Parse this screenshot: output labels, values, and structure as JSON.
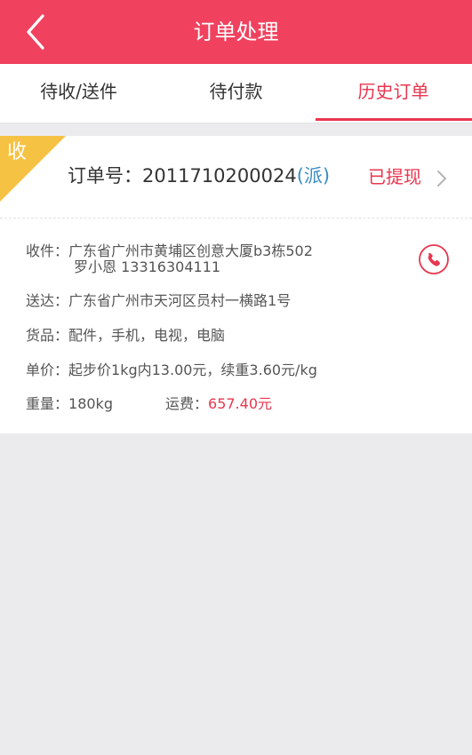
{
  "header": {
    "title": "订单处理"
  },
  "tabs": [
    {
      "label": "待收/送件",
      "active": false
    },
    {
      "label": "待付款",
      "active": false
    },
    {
      "label": "历史订单",
      "active": true
    }
  ],
  "order": {
    "badge": "收",
    "number_label": "订单号：",
    "number": "2011710200024",
    "type": "(派)",
    "status": "已提现",
    "receiver_label": "收件：",
    "receiver_address": "广东省广州市黄埔区创意大厦b3栋502",
    "receiver_contact": "罗小恩 13316304111",
    "deliver_label": "送达：",
    "deliver_address": "广东省广州市天河区员村一横路1号",
    "goods_label": "货品：",
    "goods": "配件，手机，电视，电脑",
    "price_label": "单价：",
    "price": "起步价1kg内13.00元，续重3.60元/kg",
    "weight_label": "重量：",
    "weight": "180kg",
    "freight_label": "运费：",
    "freight": "657.40元"
  },
  "colors": {
    "brand": "#f0415e",
    "accent_red": "#e8364f",
    "badge_yellow": "#f6c244",
    "link_blue": "#3a8dc5"
  },
  "icons": {
    "back": "chevron-left-icon",
    "chevron": "chevron-right-icon",
    "phone": "phone-icon"
  }
}
